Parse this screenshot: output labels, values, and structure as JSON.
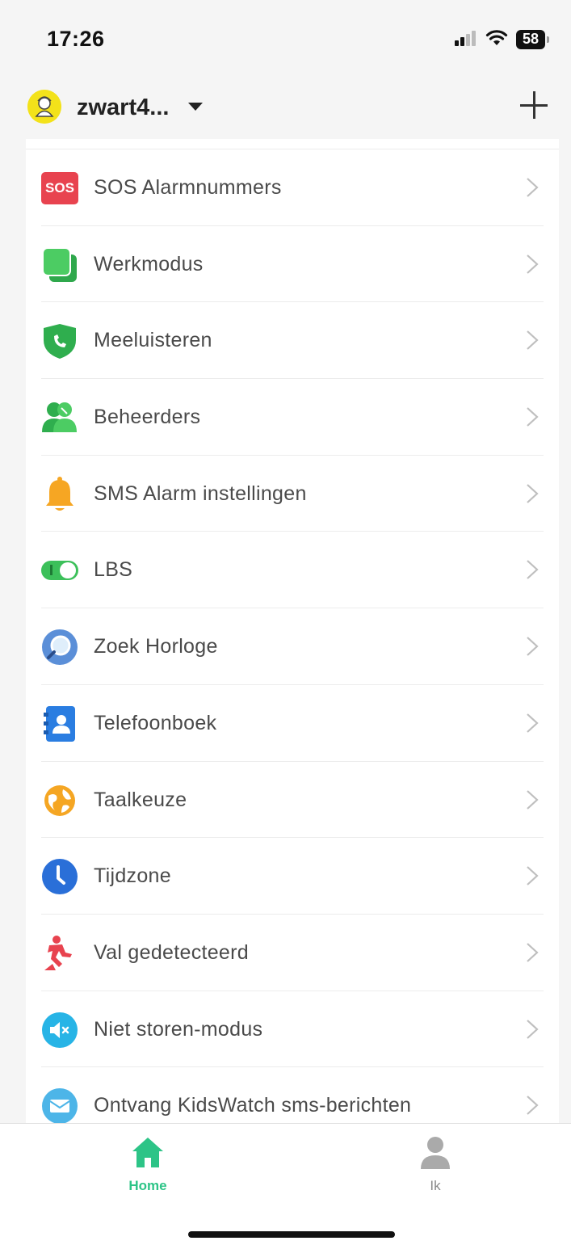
{
  "status_bar": {
    "time": "17:26",
    "battery": "58"
  },
  "header": {
    "device_name": "zwart4..."
  },
  "menu": {
    "items": [
      {
        "label": "SOS Alarmnummers",
        "icon": "sos-icon",
        "badge": "SOS",
        "color": "#e8434f"
      },
      {
        "label": "Werkmodus",
        "icon": "work-mode-icon",
        "color": "#3cc05a"
      },
      {
        "label": "Meeluisteren",
        "icon": "listen-shield-icon",
        "color": "#2fae4e"
      },
      {
        "label": "Beheerders",
        "icon": "admins-icon",
        "color": "#2fae4e"
      },
      {
        "label": "SMS Alarm instellingen",
        "icon": "bell-icon",
        "color": "#f6a623"
      },
      {
        "label": "LBS",
        "icon": "lbs-toggle-icon",
        "color": "#3cc05a"
      },
      {
        "label": "Zoek Horloge",
        "icon": "search-watch-icon",
        "color": "#5b8fd8"
      },
      {
        "label": "Telefoonboek",
        "icon": "phonebook-icon",
        "color": "#2a7de1"
      },
      {
        "label": "Taalkeuze",
        "icon": "globe-icon",
        "color": "#f5a623"
      },
      {
        "label": "Tijdzone",
        "icon": "clock-icon",
        "color": "#2a6fd8"
      },
      {
        "label": "Val gedetecteerd",
        "icon": "fall-detection-icon",
        "color": "#e8434f"
      },
      {
        "label": "Niet storen-modus",
        "icon": "mute-icon",
        "color": "#27b4e6"
      },
      {
        "label": "Ontvang KidsWatch sms-berichten",
        "icon": "message-icon",
        "color": "#4db5e8"
      }
    ]
  },
  "tabs": {
    "home": {
      "label": "Home",
      "icon": "home-icon",
      "color": "#2dc487"
    },
    "me": {
      "label": "Ik",
      "icon": "person-icon",
      "color": "#aaaaaa"
    }
  }
}
